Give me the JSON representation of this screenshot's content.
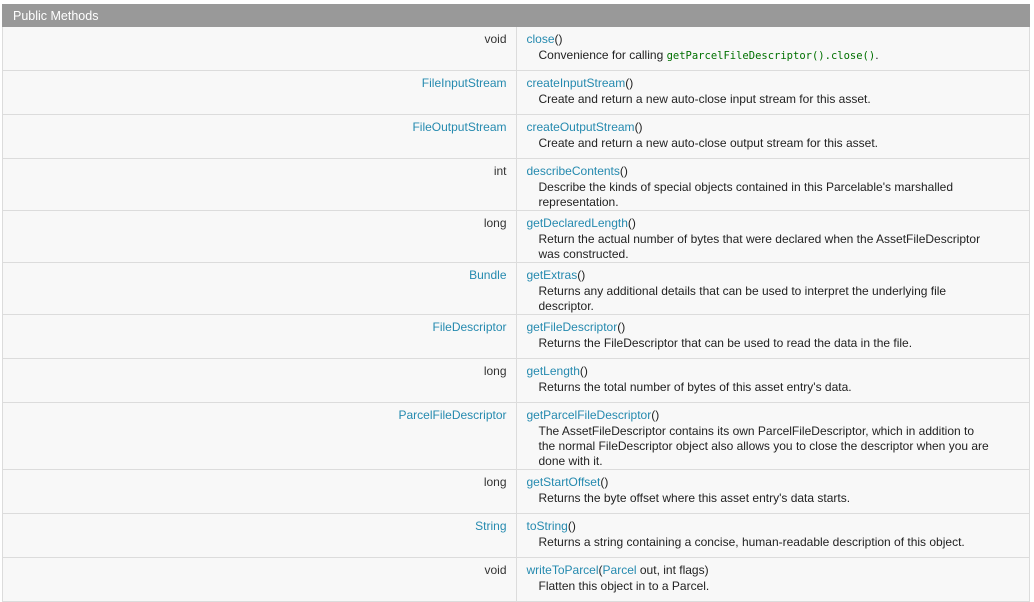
{
  "header": {
    "title": "Public Methods"
  },
  "methods": [
    {
      "rtype": "void",
      "rtype_link": false,
      "name": "close",
      "params": "()",
      "desc_pre": "Convenience for calling ",
      "desc_code": "getParcelFileDescriptor().close()",
      "desc_post": "."
    },
    {
      "rtype": "FileInputStream",
      "rtype_link": true,
      "name": "createInputStream",
      "params": "()",
      "desc": "Create and return a new auto-close input stream for this asset."
    },
    {
      "rtype": "FileOutputStream",
      "rtype_link": true,
      "name": "createOutputStream",
      "params": "()",
      "desc": "Create and return a new auto-close output stream for this asset."
    },
    {
      "rtype": "int",
      "rtype_link": false,
      "name": "describeContents",
      "params": "()",
      "desc": "Describe the kinds of special objects contained in this Parcelable's marshalled representation."
    },
    {
      "rtype": "long",
      "rtype_link": false,
      "name": "getDeclaredLength",
      "params": "()",
      "desc": "Return the actual number of bytes that were declared when the AssetFileDescriptor was constructed."
    },
    {
      "rtype": "Bundle",
      "rtype_link": true,
      "name": "getExtras",
      "params": "()",
      "desc": "Returns any additional details that can be used to interpret the underlying file descriptor."
    },
    {
      "rtype": "FileDescriptor",
      "rtype_link": true,
      "name": "getFileDescriptor",
      "params": "()",
      "desc": "Returns the FileDescriptor that can be used to read the data in the file."
    },
    {
      "rtype": "long",
      "rtype_link": false,
      "name": "getLength",
      "params": "()",
      "desc": "Returns the total number of bytes of this asset entry's data."
    },
    {
      "rtype": "ParcelFileDescriptor",
      "rtype_link": true,
      "name": "getParcelFileDescriptor",
      "params": "()",
      "desc": "The AssetFileDescriptor contains its own ParcelFileDescriptor, which in addition to the normal FileDescriptor object also allows you to close the descriptor when you are done with it."
    },
    {
      "rtype": "long",
      "rtype_link": false,
      "name": "getStartOffset",
      "params": "()",
      "desc": "Returns the byte offset where this asset entry's data starts."
    },
    {
      "rtype": "String",
      "rtype_link": true,
      "name": "toString",
      "params": "()",
      "desc": "Returns a string containing a concise, human-readable description of this object."
    },
    {
      "rtype": "void",
      "rtype_link": false,
      "name": "writeToParcel",
      "params_open": "(",
      "param_type": "Parcel",
      "params_rest": " out, int flags)",
      "desc": "Flatten this object in to a Parcel."
    }
  ]
}
